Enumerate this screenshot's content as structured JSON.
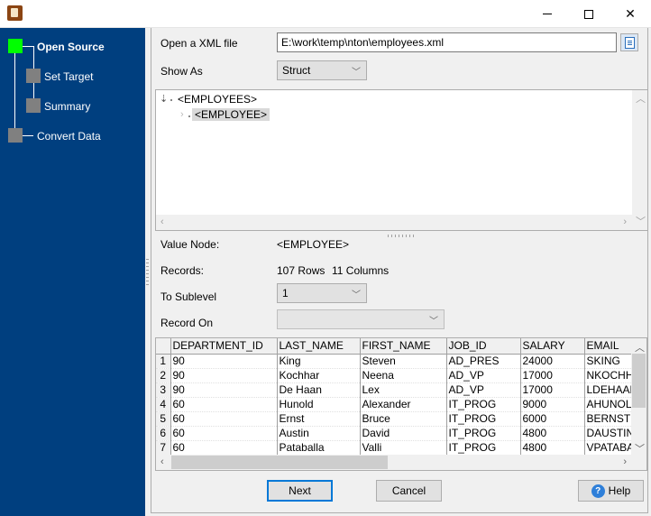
{
  "window": {
    "title": "",
    "controls": {
      "minimize": "minimize",
      "maximize": "maximize",
      "close": "close"
    }
  },
  "sidebar": {
    "steps": [
      {
        "label": "Open Source",
        "active": true
      },
      {
        "label": "Set Target",
        "active": false
      },
      {
        "label": "Summary",
        "active": false
      },
      {
        "label": "Convert Data",
        "active": false
      }
    ],
    "colors": {
      "background": "#003f7f",
      "active": "#00ff00",
      "inactive": "#808080"
    }
  },
  "form": {
    "open_label": "Open a XML file",
    "file_path": "E:\\work\\temp\\nton\\employees.xml",
    "show_as_label": "Show As",
    "show_as_value": "Struct",
    "value_node_label": "Value Node:",
    "value_node": "<EMPLOYEE>",
    "records_label": "Records:",
    "records_rows": "107 Rows",
    "records_cols": "11 Columns",
    "sublevel_label": "To Sublevel",
    "sublevel_value": "1",
    "record_on_label": "Record On",
    "record_on_value": ""
  },
  "tree": {
    "root": "<EMPLOYEES>",
    "child": "<EMPLOYEE>"
  },
  "grid": {
    "columns": [
      "DEPARTMENT_ID",
      "LAST_NAME",
      "FIRST_NAME",
      "JOB_ID",
      "SALARY",
      "EMAIL"
    ],
    "rows": [
      [
        "1",
        "90",
        "King",
        "Steven",
        "AD_PRES",
        "24000",
        "SKING"
      ],
      [
        "2",
        "90",
        "Kochhar",
        "Neena",
        "AD_VP",
        "17000",
        "NKOCHHAR"
      ],
      [
        "3",
        "90",
        "De Haan",
        "Lex",
        "AD_VP",
        "17000",
        "LDEHAAN"
      ],
      [
        "4",
        "60",
        "Hunold",
        "Alexander",
        "IT_PROG",
        "9000",
        "AHUNOLD"
      ],
      [
        "5",
        "60",
        "Ernst",
        "Bruce",
        "IT_PROG",
        "6000",
        "BERNST"
      ],
      [
        "6",
        "60",
        "Austin",
        "David",
        "IT_PROG",
        "4800",
        "DAUSTIN"
      ],
      [
        "7",
        "60",
        "Pataballa",
        "Valli",
        "IT_PROG",
        "4800",
        "VPATABAL"
      ]
    ]
  },
  "buttons": {
    "next": "Next",
    "cancel": "Cancel",
    "help": "Help"
  }
}
